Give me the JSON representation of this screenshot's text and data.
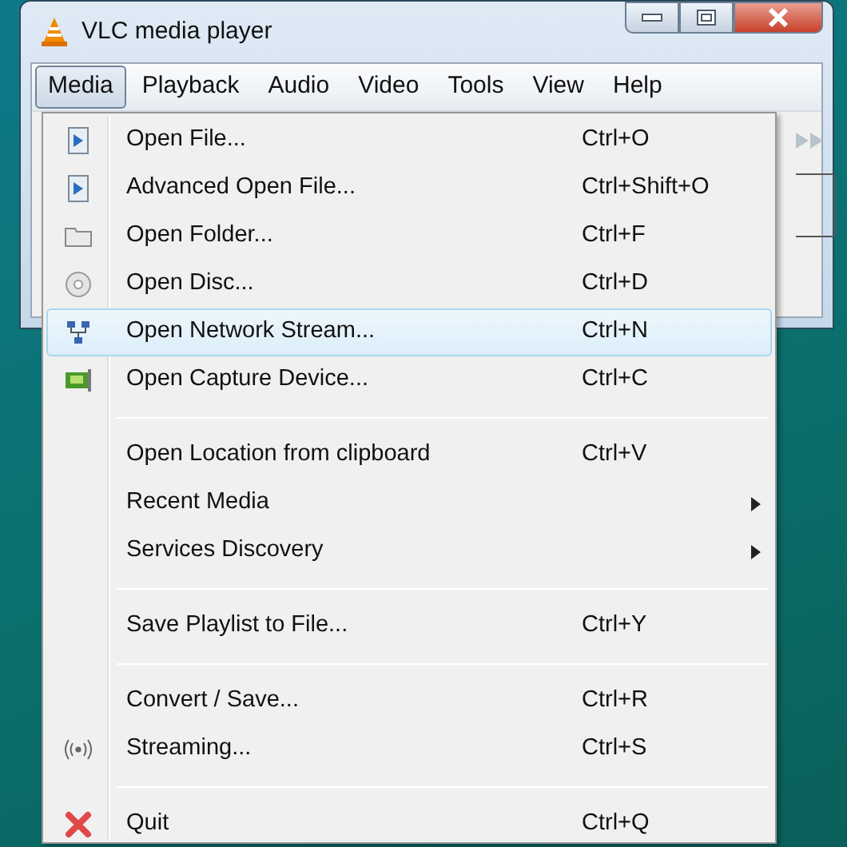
{
  "window": {
    "title": "VLC media player"
  },
  "menu_bar": [
    {
      "label": "Media",
      "selected": true
    },
    {
      "label": "Playback",
      "selected": false
    },
    {
      "label": "Audio",
      "selected": false
    },
    {
      "label": "Video",
      "selected": false
    },
    {
      "label": "Tools",
      "selected": false
    },
    {
      "label": "View",
      "selected": false
    },
    {
      "label": "Help",
      "selected": false
    }
  ],
  "menu": [
    {
      "kind": "item",
      "label": "Open File...",
      "shortcut": "Ctrl+O",
      "selected": false
    },
    {
      "kind": "item",
      "label": "Advanced Open File...",
      "shortcut": "Ctrl+Shift+O",
      "selected": false
    },
    {
      "kind": "item",
      "label": "Open Folder...",
      "shortcut": "Ctrl+F",
      "selected": false
    },
    {
      "kind": "item",
      "label": "Open Disc...",
      "shortcut": "Ctrl+D",
      "selected": false
    },
    {
      "kind": "item",
      "label": "Open Network Stream...",
      "shortcut": "Ctrl+N",
      "selected": true
    },
    {
      "kind": "item",
      "label": "Open Capture Device...",
      "shortcut": "Ctrl+C",
      "selected": false
    },
    {
      "kind": "separator"
    },
    {
      "kind": "item",
      "label": "Open Location from clipboard",
      "shortcut": "Ctrl+V",
      "selected": false
    },
    {
      "kind": "submenu",
      "label": "Recent Media",
      "selected": false
    },
    {
      "kind": "submenu",
      "label": "Services Discovery",
      "selected": false
    },
    {
      "kind": "separator"
    },
    {
      "kind": "item",
      "label": "Save Playlist to File...",
      "shortcut": "Ctrl+Y",
      "selected": false
    },
    {
      "kind": "separator"
    },
    {
      "kind": "item",
      "label": "Convert / Save...",
      "shortcut": "Ctrl+R",
      "selected": false
    },
    {
      "kind": "item",
      "label": "Streaming...",
      "shortcut": "Ctrl+S",
      "selected": false
    },
    {
      "kind": "separator"
    },
    {
      "kind": "item",
      "label": "Quit",
      "shortcut": "Ctrl+Q",
      "selected": false
    }
  ]
}
